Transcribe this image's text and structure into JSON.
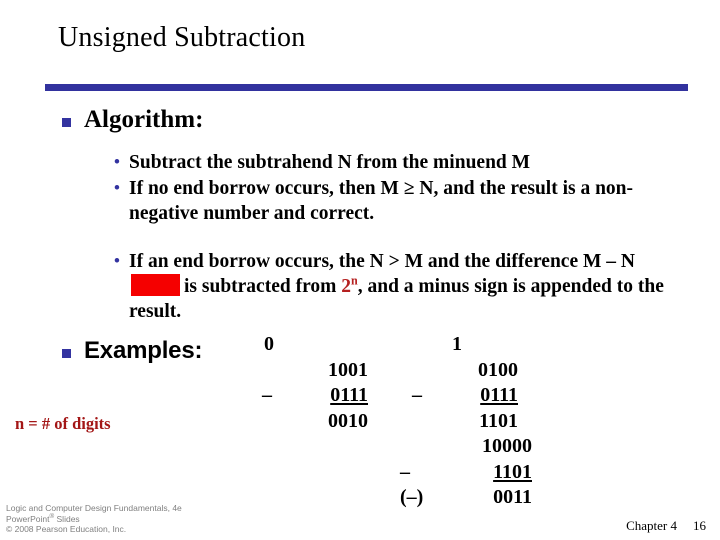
{
  "slide": {
    "title": "Unsigned Subtraction",
    "divider_color": "#32329e",
    "bullet_color": "#3333a0",
    "accent_red": "#b52020",
    "redaction_color": "#f50000"
  },
  "sections": {
    "algorithm": {
      "heading": "Algorithm:",
      "bullets": [
        "Subtract the subtrahend N from the minuend M",
        "If no end borrow occurs, then M ≥ N, and the result is a non-negative number and correct.",
        {
          "part1": "If an end borrow occurs, the N > M and the difference M – N",
          "redaction": "",
          "part2": "is subtracted from",
          "accent": "2",
          "accent_sup": "n",
          "part3": ", and a minus sign is appended to the result."
        }
      ]
    },
    "examples": {
      "heading": "Examples:",
      "note": "n = # of digits",
      "left_column": {
        "borrow": "0",
        "minuend": "1001",
        "operator": "–",
        "subtrahend": "0111",
        "result": "0010"
      },
      "right_column": {
        "borrow": "1",
        "minuend": "0100",
        "operator": "–",
        "subtrahend": "0111",
        "result": "1101",
        "correction_minuend": "10000",
        "correction_operator": "–",
        "correction_subtrahend": "1101",
        "correction_sign": "(–)",
        "correction_result": "0011"
      }
    }
  },
  "footer": {
    "line1": "Logic and Computer Design Fundamentals, 4e",
    "line2_pre": "PowerPoint",
    "line2_sup": "®",
    "line2_post": " Slides",
    "line3": "© 2008 Pearson Education, Inc.",
    "chapter": "Chapter 4",
    "page": "16"
  }
}
